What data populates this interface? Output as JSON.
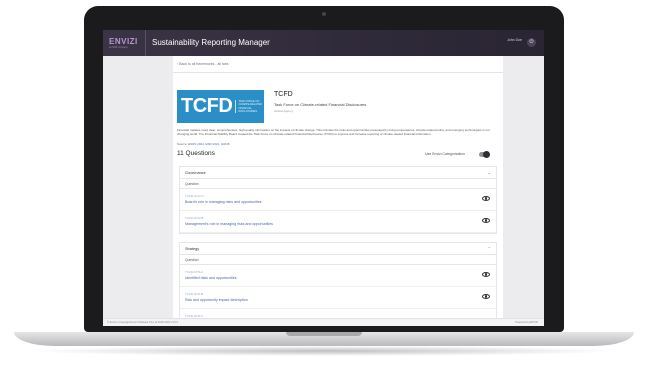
{
  "header": {
    "logo_text": "ENVIZI",
    "logo_sub": "an IBM company",
    "app_title": "Sustainability Reporting Manager",
    "user_name": "John Doe",
    "logout_glyph": "⏻"
  },
  "page": {
    "back_link": "‹  Back to all frameworks - all tabs",
    "framework": {
      "logo_big": "TCFD",
      "logo_small": "TASK FORCE ON CLIMATE-RELATED FINANCIAL DISCLOSURES",
      "title": "TCFD",
      "subtitle": "Task Force on Climate-related Financial Disclosures",
      "meta": "Global Agency"
    },
    "description": "Financial markets need clear, comprehensive, high-quality information on the impacts of climate change. This includes the risks and opportunities presented by rising temperatures, climate-related policy, and emerging technologies in our changing world. The Financial Stability Board created the Task Force on Climate-related Financial Disclosures (TCFD) to improve and increase reporting of climate-related financial information.",
    "source_label": "Source:",
    "source_links": "ESRS 2024, ESR 2021, GRI45",
    "question_count": "11 Questions",
    "toggle_label": "Use Envizi Categorization"
  },
  "sections": [
    {
      "title": "Governance",
      "chevron": "⌄",
      "column": "Question",
      "rows": [
        {
          "code": "TCFD-GOV-A",
          "text": "Board's role in managing risks and opportunities"
        },
        {
          "code": "TCFD-GOV-B",
          "text": "Management's role in managing risks and opportunities"
        }
      ]
    },
    {
      "title": "Strategy",
      "chevron": "⌃",
      "column": "Question",
      "rows": [
        {
          "code": "TCFD-STR-A",
          "text": "Identified risks and opportunities"
        },
        {
          "code": "TCFD-STR-B",
          "text": "Risk and opportunity impact description"
        },
        {
          "code": "TCFD-STR-C",
          "text": ""
        }
      ]
    }
  ],
  "footer": {
    "left": "© Envizi | Copyright Envizi Software Pty Ltd 2018-2023 v4.0.0",
    "right": "Powered by ENVIZI"
  },
  "colors": {
    "header_bg": "#2f2a39",
    "tcfd_blue": "#2b8fc7",
    "link_blue": "#4a63ad"
  }
}
